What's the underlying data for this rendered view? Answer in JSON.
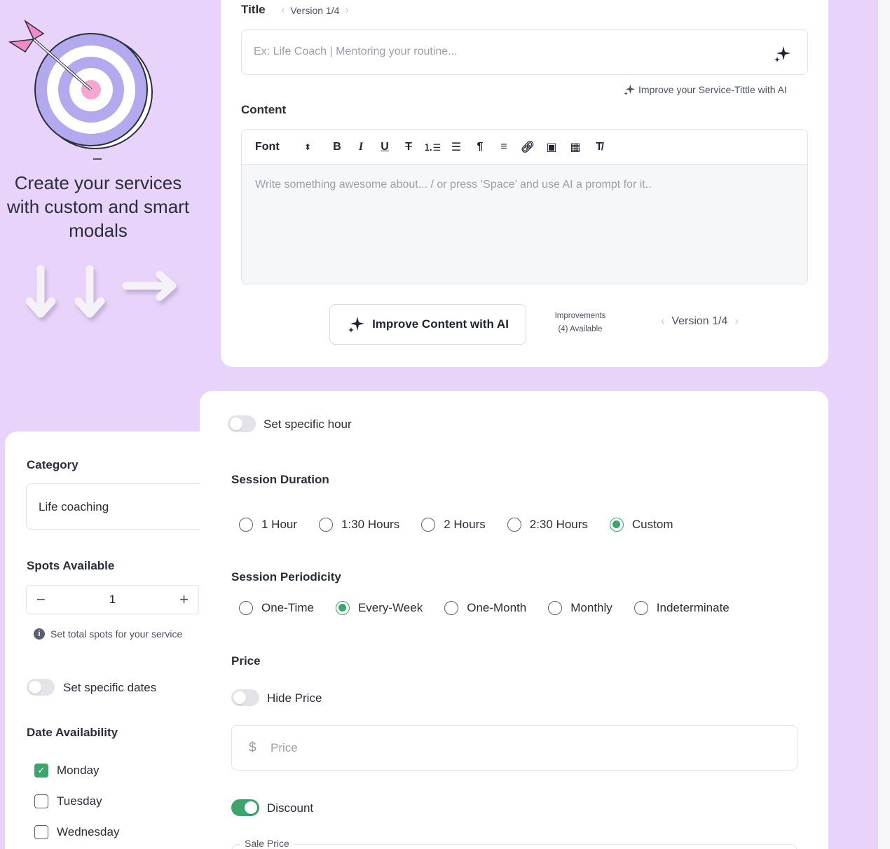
{
  "colors": {
    "background": "#e8d4fa",
    "accent": "#3ba56c",
    "card": "#ffffff"
  },
  "promo": {
    "text": "Create your services with custom and smart modals"
  },
  "title_section": {
    "label": "Title",
    "version": "Version  1/4",
    "placeholder": "Ex: Life Coach | Mentoring your routine...",
    "ai_hint": "Improve your Service-Tittle with AI"
  },
  "content_section": {
    "label": "Content",
    "font_select": "Font",
    "toolbar_icons": [
      "bold-icon",
      "italic-icon",
      "underline-icon",
      "strikethrough-icon",
      "ordered-list-icon",
      "bullet-list-icon",
      "paragraph-icon",
      "align-left-icon",
      "link-icon",
      "image-icon",
      "video-icon",
      "clear-format-icon"
    ],
    "placeholder": "Write something awesome about... / or press ‘Space’ and use AI a prompt for it..",
    "improve_button": "Improve Content with AI",
    "improvements_label": "Improvements",
    "improvements_available": "(4) Available",
    "version": "Version  1/4"
  },
  "left_panel": {
    "category_label": "Category",
    "category_value": "Life coaching",
    "spots_label": "Spots Available",
    "spots_value": "1",
    "spots_hint": "Set total spots for your service",
    "specific_dates_label": "Set specific dates",
    "date_availability_label": "Date Availability",
    "days": [
      {
        "label": "Monday",
        "checked": true
      },
      {
        "label": "Tuesday",
        "checked": false
      },
      {
        "label": "Wednesday",
        "checked": false
      }
    ]
  },
  "right_panel": {
    "specific_hour_label": "Set specific hour",
    "duration_label": "Session Duration",
    "durations": [
      {
        "label": "1 Hour",
        "selected": false
      },
      {
        "label": "1:30 Hours",
        "selected": false
      },
      {
        "label": "2 Hours",
        "selected": false
      },
      {
        "label": "2:30 Hours",
        "selected": false
      },
      {
        "label": "Custom",
        "selected": true
      }
    ],
    "periodicity_label": "Session Periodicity",
    "periodicities": [
      {
        "label": "One-Time",
        "selected": false
      },
      {
        "label": "Every-Week",
        "selected": true
      },
      {
        "label": "One-Month",
        "selected": false
      },
      {
        "label": "Monthly",
        "selected": false
      },
      {
        "label": "Indeterminate",
        "selected": false
      }
    ],
    "price_label": "Price",
    "hide_price_label": "Hide Price",
    "currency_symbol": "$",
    "price_placeholder": "Price",
    "discount_label": "Discount",
    "discount_on": true,
    "sale_price_label": "Sale Price"
  }
}
